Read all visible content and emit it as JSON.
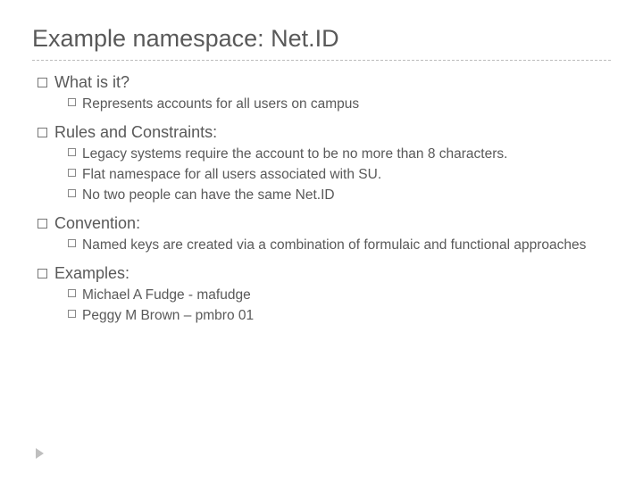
{
  "title": "Example namespace: Net.ID",
  "sections": [
    {
      "heading": "What is it?",
      "items": [
        "Represents accounts for all users on campus"
      ]
    },
    {
      "heading": "Rules and Constraints:",
      "items": [
        "Legacy systems require the account to be no more than 8 characters.",
        "Flat namespace for all users associated with SU.",
        "No two people can have the same Net.ID"
      ]
    },
    {
      "heading": "Convention:",
      "items": [
        "Named keys are created via a combination of formulaic and functional approaches"
      ]
    },
    {
      "heading": "Examples:",
      "items": [
        "Michael A Fudge -  mafudge",
        "Peggy M Brown – pmbro 01"
      ]
    }
  ]
}
